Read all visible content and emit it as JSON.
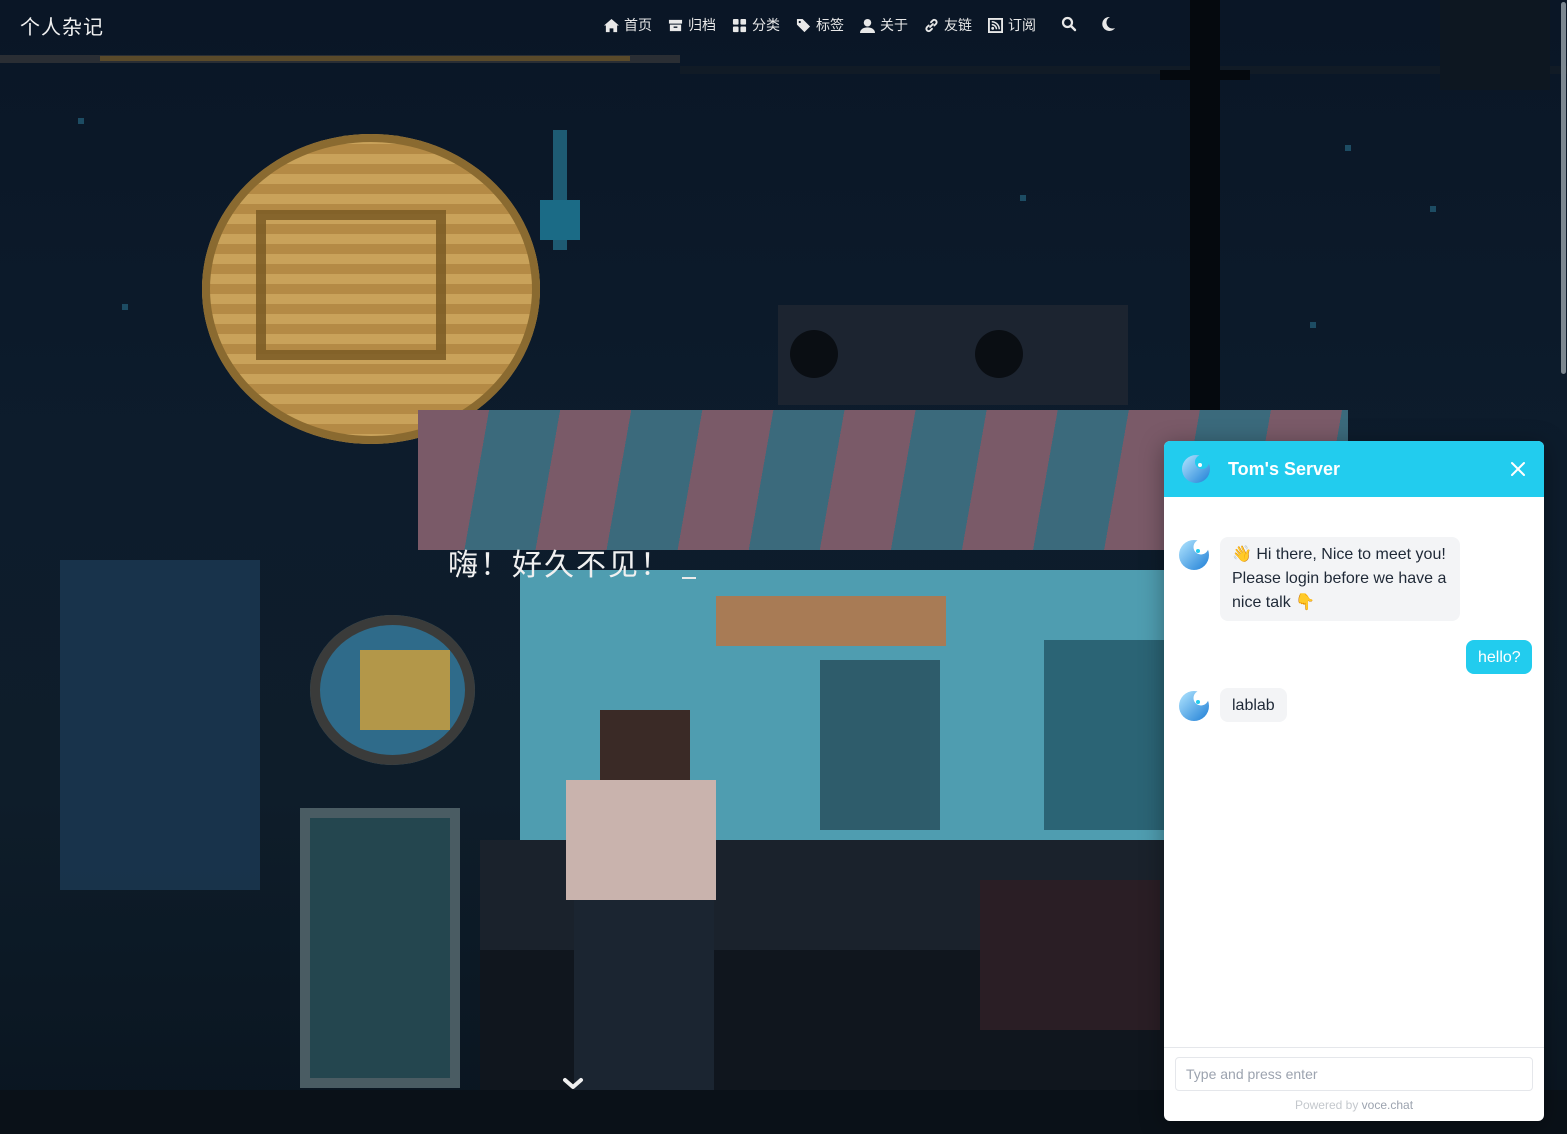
{
  "site": {
    "title": "个人杂记"
  },
  "nav": {
    "items": [
      {
        "label": "首页",
        "icon": "home-icon"
      },
      {
        "label": "归档",
        "icon": "archive-icon"
      },
      {
        "label": "分类",
        "icon": "categories-icon"
      },
      {
        "label": "标签",
        "icon": "tags-icon"
      },
      {
        "label": "关于",
        "icon": "user-icon"
      },
      {
        "label": "友链",
        "icon": "link-icon"
      },
      {
        "label": "订阅",
        "icon": "rss-icon"
      }
    ],
    "search_icon": "search-icon",
    "theme_icon": "moon-icon"
  },
  "hero": {
    "greeting": "嗨！好久不见！"
  },
  "chat": {
    "header_title": "Tom's Server",
    "accent": "#22ccee",
    "messages": [
      {
        "from": "bot",
        "text": "👋 Hi there, Nice to meet you! Please login before we have a nice talk 👇"
      },
      {
        "from": "me",
        "text": "hello?"
      },
      {
        "from": "bot",
        "text": "lablab"
      }
    ],
    "input_placeholder": "Type and press enter",
    "powered_prefix": "Powered by",
    "powered_brand": "voce.chat"
  }
}
